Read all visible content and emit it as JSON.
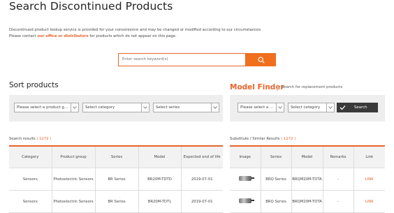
{
  "page": {
    "title": "Search Discontinued Products"
  },
  "notice": {
    "line1": "Discontinued product lookup service is provided for your convenience and may be changed or modified according to our circumstances.",
    "line2_pre": "Please contact ",
    "line2_link": "our office or distributors",
    "line2_post": " for products which do not appear on this page."
  },
  "search": {
    "placeholder": "Enter search keyword(s)"
  },
  "sort": {
    "title": "Sort products",
    "selects": [
      "Please select a product g...",
      "Select category",
      "Select series"
    ]
  },
  "finder": {
    "title": "Model Finder",
    "subtitle": "Search for replacement products",
    "selects": [
      "Please select a ...",
      "Select category"
    ],
    "search_label": "Search"
  },
  "results": {
    "label": "Search results",
    "count": "( 1272 )",
    "headers": [
      "Category",
      "Product group",
      "Series",
      "Model",
      "Expected end of life"
    ],
    "rows": [
      [
        "Sensors",
        "Photoelectric Sensors",
        "BR Series",
        "BR20M-TDTD",
        "2019-07-01"
      ],
      [
        "Sensors",
        "Photoelectric Sensors",
        "BR Series",
        "BR20M-TDTL",
        "2019-07-01"
      ]
    ]
  },
  "substitute": {
    "label": "Substitute / Similar Results",
    "count": "( 1272 )",
    "headers": [
      "Image",
      "Series",
      "Model",
      "Remarks",
      "Link"
    ],
    "rows": [
      [
        "BRQ Series",
        "BRQM20M-TDTA",
        "-",
        "LINK"
      ],
      [
        "BRQ Series",
        "BRQM20M-TDTA",
        "-",
        "LINK"
      ]
    ]
  },
  "colors": {
    "accent": "#e8642c",
    "button_dark": "#3a3a3a",
    "panel": "#eeeeee"
  },
  "icons": {
    "search": "search-icon",
    "dropdown": "chevron-down-icon",
    "check": "check-icon"
  }
}
